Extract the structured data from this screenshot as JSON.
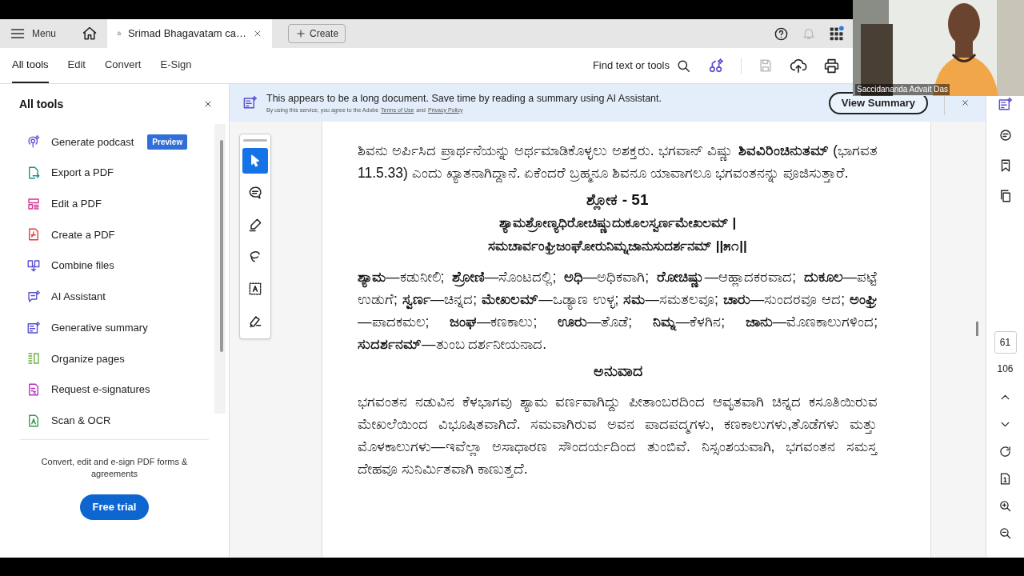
{
  "tab_bar": {
    "menu": "Menu",
    "document_tab": {
      "title": "Srimad Bhagavatam ca…"
    },
    "create": "Create"
  },
  "toolbar": {
    "tabs": [
      {
        "label": "All tools",
        "selected": true
      },
      {
        "label": "Edit",
        "selected": false
      },
      {
        "label": "Convert",
        "selected": false
      },
      {
        "label": "E-Sign",
        "selected": false
      }
    ],
    "find": "Find text or tools",
    "save_disabled": true
  },
  "tools_panel": {
    "title": "All tools",
    "items": [
      {
        "kind": "podcast",
        "label": "Generate podcast",
        "badge": "Preview"
      },
      {
        "kind": "export",
        "label": "Export a PDF"
      },
      {
        "kind": "edit",
        "label": "Edit a PDF"
      },
      {
        "kind": "create",
        "label": "Create a PDF"
      },
      {
        "kind": "combine",
        "label": "Combine files"
      },
      {
        "kind": "assistant",
        "label": "AI Assistant"
      },
      {
        "kind": "summary",
        "label": "Generative summary"
      },
      {
        "kind": "organize",
        "label": "Organize pages"
      },
      {
        "kind": "esign",
        "label": "Request e-signatures"
      },
      {
        "kind": "scan",
        "label": "Scan & OCR"
      }
    ],
    "promo": "Convert, edit and e-sign PDF forms & agreements",
    "button": "Free trial"
  },
  "banner": {
    "message": "This appears to be a long document. Save time by reading a summary using AI Assistant.",
    "legal_prefix": "By using this service, you agree to the Adobe",
    "terms_link": "Terms of Use",
    "legal_and": "and",
    "privacy_link": "Privacy Policy",
    "button": "View Summary"
  },
  "tool_palette": [
    {
      "kind": "select",
      "selected": true
    },
    {
      "kind": "comment",
      "selected": false
    },
    {
      "kind": "highlight",
      "selected": false
    },
    {
      "kind": "draw",
      "selected": false
    },
    {
      "kind": "text",
      "selected": false
    },
    {
      "kind": "sign",
      "selected": false
    }
  ],
  "document": {
    "blocks": [
      {
        "kind": "paragraph",
        "text": "ಶಿವನು ಅರ್ಪಿಸಿದ ಪ್ರಾರ್ಥನೆಯನ್ನು ಅರ್ಥಮಾಡಿಕೊಳ್ಳಲು ಅಶಕ್ತರು. ಭಗವಾನ್ ವಿಷ್ಣು **ಶಿವವಿರಿಂಚಿನುತಮ್** (ಭಾಗವತ 11.5.33) ಎಂದು ಖ್ಯಾತನಾಗಿದ್ದಾನೆ. ಏಕೆಂದರೆ ಬ್ರಹ್ಮನೂ ಶಿವನೂ ಯಾವಾಗಲೂ ಭಗವಂತನನ್ನು ಪೂಜಿಸುತ್ತಾರೆ."
      },
      {
        "kind": "heading",
        "text": "ಶ್ಲೋಕ - 51"
      },
      {
        "kind": "verse",
        "lines": [
          "ಶ್ಯಾಮಶ್ರೋಣ್ಯಧಿರೋಚಿಷ್ಣುದುಕೂಲಸ್ವರ್ಣಮೇಖಲಮ್ |",
          "ಸಮಚಾರ್ವಂಘ್ರಿಜಂಘೋರುನಿಮ್ನಜಾನುಸುದರ್ಶನಮ್ ||೫೧||"
        ]
      },
      {
        "kind": "paragraph",
        "text": "**ಶ್ಯಾಮ**—ಕಡುನೀಲಿ; **ಶ್ರೋಣಿ**—ಸೊಂಟದಲ್ಲಿ; **ಅಧಿ**—ಅಧಿಕವಾಗಿ; **ರೋಚಿಷ್ಣು**—ಆಹ್ಲಾದಕರವಾದ; **ದುಕೂಲ**—ಪಟ್ಟೆ ಉಡುಗೆ; **ಸ್ವರ್ಣ**—ಚಿನ್ನದ; **ಮೇಖಲಮ್**—ಒಡ್ಯಾಣ ಉಳ್ಳ; **ಸಮ**—ಸಮತಲವೂ; **ಚಾರು**—ಸುಂದರವೂ ಆದ; **ಅಂಘ್ರಿ**—ಪಾದಕಮಲ; **ಜಂಘ**—ಕಣಕಾಲು; **ಊರು**—ತೊಡೆ; **ನಿಮ್ನ**—ಕೆಳಗಿನ; **ಜಾನು**—ಮೊಣಕಾಲುಗಳಿಂದ; **ಸುದರ್ಶನಮ್**—ತುಂಬ ದರ್ಶನೀಯನಾದ."
      },
      {
        "kind": "heading",
        "text": "ಅನುವಾದ"
      },
      {
        "kind": "paragraph",
        "text": "ಭಗವಂತನ ನಡುವಿನ ಕೆಳಭಾಗವು ಶ್ಯಾಮ ವರ್ಣವಾಗಿದ್ದು ಪೀತಾಂಬರದಿಂದ ಆವೃತವಾಗಿ ಚಿನ್ನದ ಕಸೂತಿಯಿರುವ ಮೇಖಲೆಯಿಂದ ವಿಭೂಷಿತವಾಗಿದೆ. ಸಮವಾಗಿರುವ ಅವನ ಪಾದಪದ್ಮಗಳು, ಕಣಕಾಲುಗಳು,ತೊಡೆಗಳು ಮತ್ತು ಮೊಳಕಾಲುಗಳು—ಇವೆಲ್ಲಾ ಅಸಾಧಾರಣ ಸೌಂದರ್ಯದಿಂದ ತುಂಬಿವೆ. ನಿಸ್ಸಂಶಯವಾಗಿ, ಭಗವಂತನ ಸಮಸ್ತ ದೇಹವೂ ಸುನಿರ್ಮಿತವಾಗಿ ಕಾಣುತ್ತದೆ."
      }
    ]
  },
  "page_nav": {
    "current": "61",
    "total": "106"
  },
  "video": {
    "name": "Saccidananda Advait Das"
  }
}
